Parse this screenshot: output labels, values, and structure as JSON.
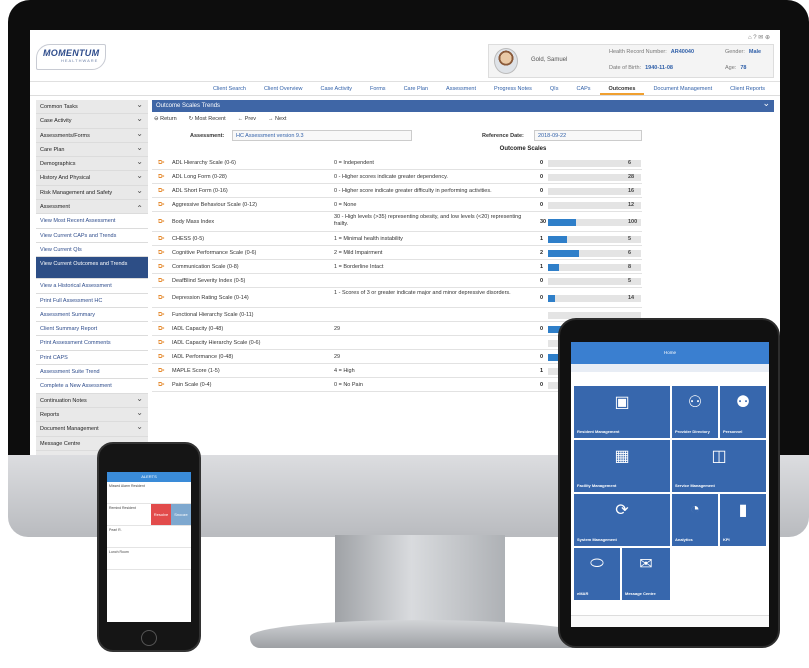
{
  "app": {
    "brand": "MOMENTUM",
    "brand_sub": "HEALTHWARE",
    "top_icons": "⌂ ? ✉ ⊕"
  },
  "patient": {
    "name": "Gold, Samuel",
    "hr_label": "Health Record Number:",
    "hr_value": "AR40040",
    "gender_label": "Gender:",
    "gender_value": "Male",
    "dob_label": "Date of Birth:",
    "dob_value": "1940-11-08",
    "age_label": "Age:",
    "age_value": "78"
  },
  "nav": {
    "items": [
      "Client Search",
      "Client Overview",
      "Case Activity",
      "Forms",
      "Care Plan",
      "Assessment",
      "Progress Notes",
      "QIs",
      "CAPs",
      "Outcomes",
      "Document Management",
      "Client Reports"
    ],
    "active": "Outcomes"
  },
  "sidebar": {
    "items": [
      {
        "label": "Common Tasks",
        "type": "cat"
      },
      {
        "label": "Case Activity",
        "type": "cat"
      },
      {
        "label": "Assessments/Forms",
        "type": "cat"
      },
      {
        "label": "Care Plan",
        "type": "cat"
      },
      {
        "label": "Demographics",
        "type": "cat"
      },
      {
        "label": "History And Physical",
        "type": "cat"
      },
      {
        "label": "Risk Management and Safety",
        "type": "cat"
      },
      {
        "label": "Assessment",
        "type": "open"
      },
      {
        "label": "View Most Recent Assessment",
        "type": "sub"
      },
      {
        "label": "View Current CAPs and Trends",
        "type": "sub"
      },
      {
        "label": "View Current QIs",
        "type": "sub"
      },
      {
        "label": "View Current Outcomes and Trends",
        "type": "sel"
      },
      {
        "label": "View a Historical Assessment",
        "type": "sub"
      },
      {
        "label": "Print Full Assessment HC",
        "type": "sub"
      },
      {
        "label": "Assessment Summary",
        "type": "sub"
      },
      {
        "label": "Client Summary Report",
        "type": "sub"
      },
      {
        "label": "Print Assessment Comments",
        "type": "sub"
      },
      {
        "label": "Print CAPS",
        "type": "sub"
      },
      {
        "label": "Assessment Suite Trend",
        "type": "sub"
      },
      {
        "label": "Complete a New Assessment",
        "type": "sub"
      },
      {
        "label": "Continuation Notes",
        "type": "cat"
      },
      {
        "label": "Reports",
        "type": "cat"
      },
      {
        "label": "Document Management",
        "type": "cat"
      },
      {
        "label": "Message Centre",
        "type": "cat"
      },
      {
        "label": "User Preferences",
        "type": "cat"
      }
    ]
  },
  "panel": {
    "title": "Outcome Scales Trends",
    "return": "Return",
    "most_recent": "Most Recent",
    "prev": "Prev",
    "next": "Next",
    "assessment_label": "Assessment:",
    "assessment_value": "HC Assessment version 9.3",
    "ref_date_label": "Reference Date:",
    "ref_date_value": "2018-09-22",
    "scales_title": "Outcome Scales"
  },
  "scales": [
    {
      "name": "ADL Hierarchy Scale (0-6)",
      "desc": "0 = Independent",
      "value": "0",
      "max": "6",
      "pct": 0
    },
    {
      "name": "ADL Long Form (0-28)",
      "desc": "0 - Higher scores indicate greater dependency.",
      "value": "0",
      "max": "28",
      "pct": 0
    },
    {
      "name": "ADL Short Form (0-16)",
      "desc": "0 - Higher score indicate greater difficulty in performing activities.",
      "value": "0",
      "max": "16",
      "pct": 0
    },
    {
      "name": "Aggressive Behaviour Scale (0-12)",
      "desc": "0 = None",
      "value": "0",
      "max": "12",
      "pct": 0
    },
    {
      "name": "Body Mass Index",
      "desc": "30 - High levels (>35) representing obesity, and low levels (<20) representing frailty.",
      "value": "30",
      "max": "100",
      "pct": 0.3
    },
    {
      "name": "CHESS (0-5)",
      "desc": "1 = Minimal health instability",
      "value": "1",
      "max": "5",
      "pct": 0.2
    },
    {
      "name": "Cognitive Performance Scale (0-6)",
      "desc": "2 = Mild Impairment",
      "value": "2",
      "max": "6",
      "pct": 0.33
    },
    {
      "name": "Communication Scale (0-8)",
      "desc": "1 = Borderline Intact",
      "value": "1",
      "max": "8",
      "pct": 0.12
    },
    {
      "name": "DeafBlind Severity Index (0-5)",
      "desc": "",
      "value": "0",
      "max": "5",
      "pct": 0
    },
    {
      "name": "Depression Rating Scale (0-14)",
      "desc": "1 - Scores of 3 or greater indicate major and minor depressive disorders.",
      "value": "0",
      "max": "14",
      "pct": 0.07
    },
    {
      "name": "Functional Hierarchy Scale (0-11)",
      "desc": "",
      "value": "",
      "max": "",
      "pct": 0
    },
    {
      "name": "IADL Capacity (0-48)",
      "desc": "29",
      "value": "0",
      "max": "",
      "pct": 0.6
    },
    {
      "name": "IADL Capacity Hierarchy Scale (0-6)",
      "desc": "",
      "value": "",
      "max": "",
      "pct": 0
    },
    {
      "name": "IADL Performance (0-48)",
      "desc": "29",
      "value": "0",
      "max": "",
      "pct": 0.6
    },
    {
      "name": "MAPLE Score (1-5)",
      "desc": "4 = High",
      "value": "1",
      "max": "",
      "pct": 0
    },
    {
      "name": "Pain Scale (0-4)",
      "desc": "0 = No Pain",
      "value": "0",
      "max": "",
      "pct": 0
    }
  ],
  "phone": {
    "header": "ALERTS",
    "items": [
      "Missed Alarm Resident",
      "Remind Resident",
      "Pearl R.",
      "Lunch Room"
    ],
    "swipe": [
      "Resolve",
      "Snooze"
    ]
  },
  "tablet": {
    "header": "Home",
    "tiles": [
      "Resident Management",
      "Provider Directory",
      "Personnel",
      "Facility Management",
      "Service Management",
      "System Management",
      "Analytics",
      "KPI",
      "eMAR",
      "Message Centre"
    ]
  }
}
